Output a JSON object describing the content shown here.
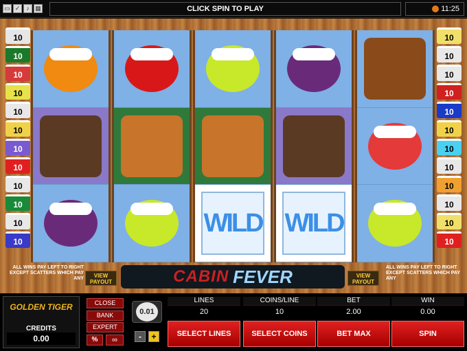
{
  "topbar": {
    "prompt": "CLICK SPIN TO PLAY",
    "clock": "11:25",
    "icons": [
      "screen-icon",
      "checkbox-icon",
      "sound-icon",
      "settings-icon"
    ]
  },
  "paylines_left": [
    "10",
    "10",
    "10",
    "10",
    "10",
    "10",
    "10",
    "10",
    "10",
    "10",
    "10",
    "10"
  ],
  "paylines_right": [
    "10",
    "10",
    "10",
    "10",
    "10",
    "10",
    "10",
    "10",
    "10",
    "10",
    "10",
    "10"
  ],
  "paylines_left_colors": [
    "#e6e6e6",
    "#1a7a2a",
    "#d73a3a",
    "#e8e24a",
    "#e8e8e8",
    "#f0d24a",
    "#7a5ad0",
    "#e02020",
    "#e8e8e8",
    "#1a8a3a",
    "#e8e8e8",
    "#3a3ac8"
  ],
  "paylines_right_colors": [
    "#f0e06a",
    "#e8e8e8",
    "#e8e8e8",
    "#d02020",
    "#1a3ac8",
    "#f0d24a",
    "#4ad0f0",
    "#e8e8e8",
    "#f0a030",
    "#e8e8e8",
    "#f0e06a",
    "#e02020"
  ],
  "reels": [
    [
      "orange",
      "bear-family",
      "plum"
    ],
    [
      "cherries",
      "chef-bear",
      "lime"
    ],
    [
      "lime",
      "chef-bear",
      "wild"
    ],
    [
      "plum",
      "bear-family",
      "wild"
    ],
    [
      "squirrel",
      "watermelon",
      "lime"
    ]
  ],
  "wild_text": "WILD",
  "logo": {
    "part1": "CABIN",
    "part2": "FEVER"
  },
  "wins_info": "ALL WINS PAY LEFT TO RIGHT EXCEPT SCATTERS WHICH PAY ANY",
  "view_payout": "VIEW PAYOUT",
  "golden_tiger": "GOLDEN TIGER",
  "credits": {
    "label": "CREDITS",
    "value": "0.00"
  },
  "side_buttons": {
    "close": "CLOSE",
    "bank": "BANK",
    "expert": "EXPERT",
    "percent": "%",
    "infinity": "∞"
  },
  "coin": {
    "value": "0.01",
    "minus": "-",
    "plus": "+"
  },
  "stats": {
    "lines": {
      "label": "LINES",
      "value": "20"
    },
    "coins_per_line": {
      "label": "COINS/LINE",
      "value": "10"
    },
    "bet": {
      "label": "BET",
      "value": "2.00"
    },
    "win": {
      "label": "WIN",
      "value": "0.00"
    }
  },
  "actions": {
    "select_lines": "SELECT LINES",
    "select_coins": "SELECT COINS",
    "bet_max": "BET MAX",
    "spin": "SPIN"
  }
}
